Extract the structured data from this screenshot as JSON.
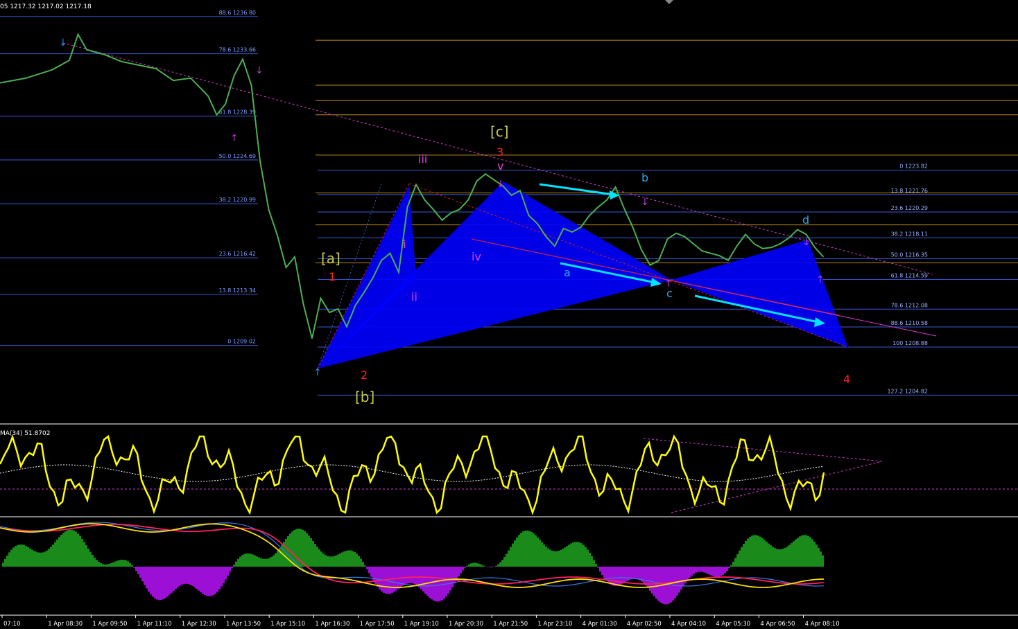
{
  "header": {
    "ohlc_text": "05 1217.32 1217.02 1217.18"
  },
  "indicator": {
    "label": "MA(34) 51.8702"
  },
  "colors": {
    "background": "#000000",
    "price_line": "#4caf50",
    "fib_left": "#3a5bd9",
    "fib_right_blue": "#3a5bd9",
    "fib_right_orange": "#c08a1a",
    "pattern_fill": "#0000ff",
    "trendline": "#d63cd6",
    "arrow": "#00e5ff",
    "rsi_line": "#ffff00",
    "hist_pos": "#1a8a1a",
    "hist_neg": "#9b10d4"
  },
  "chart_data": {
    "type": "line",
    "title": "",
    "y_range": [
      1202.5,
      1238.2
    ],
    "x_labels": [
      "07:10",
      "1 Apr 08:30",
      "1 Apr 09:50",
      "1 Apr 11:10",
      "1 Apr 12:30",
      "1 Apr 13:50",
      "1 Apr 15:10",
      "1 Apr 16:30",
      "1 Apr 17:50",
      "1 Apr 19:10",
      "1 Apr 20:30",
      "1 Apr 21:50",
      "1 Apr 23:10",
      "4 Apr 01:30",
      "4 Apr 02:50",
      "4 Apr 04:10",
      "4 Apr 05:30",
      "4 Apr 06:50",
      "4 Apr 08:10"
    ],
    "price_series": [
      [
        0,
        1231.2
      ],
      [
        3,
        1231.6
      ],
      [
        6,
        1232.3
      ],
      [
        8,
        1233.1
      ],
      [
        9,
        1235.3
      ],
      [
        10,
        1234.0
      ],
      [
        12,
        1233.6
      ],
      [
        14,
        1233.0
      ],
      [
        16,
        1232.7
      ],
      [
        18,
        1232.4
      ],
      [
        20,
        1231.4
      ],
      [
        22,
        1231.6
      ],
      [
        24,
        1230.1
      ],
      [
        25,
        1228.5
      ],
      [
        26,
        1229.4
      ],
      [
        27,
        1231.8
      ],
      [
        28,
        1233.2
      ],
      [
        29,
        1231.0
      ],
      [
        30,
        1224.6
      ],
      [
        31,
        1220.5
      ],
      [
        32,
        1218.3
      ],
      [
        33,
        1215.6
      ],
      [
        34,
        1216.5
      ],
      [
        35,
        1212.5
      ],
      [
        36,
        1209.6
      ],
      [
        37,
        1213.0
      ],
      [
        38,
        1211.8
      ],
      [
        39,
        1212.1
      ],
      [
        40,
        1210.6
      ],
      [
        41,
        1212.4
      ],
      [
        42,
        1213.5
      ],
      [
        43,
        1214.7
      ],
      [
        44,
        1216.2
      ],
      [
        45,
        1216.8
      ],
      [
        46,
        1215.2
      ],
      [
        47,
        1220.7
      ],
      [
        48,
        1222.6
      ],
      [
        49,
        1221.3
      ],
      [
        50,
        1220.5
      ],
      [
        51,
        1219.6
      ],
      [
        52,
        1220.2
      ],
      [
        53,
        1220.5
      ],
      [
        54,
        1221.3
      ],
      [
        55,
        1222.9
      ],
      [
        56,
        1223.5
      ],
      [
        57,
        1223.0
      ],
      [
        58,
        1222.5
      ],
      [
        59,
        1221.7
      ],
      [
        60,
        1222.1
      ],
      [
        61,
        1220.0
      ],
      [
        62,
        1219.3
      ],
      [
        63,
        1218.2
      ],
      [
        64,
        1217.4
      ],
      [
        65,
        1218.9
      ],
      [
        66,
        1218.6
      ],
      [
        67,
        1219.0
      ],
      [
        68,
        1220.0
      ],
      [
        69,
        1220.7
      ],
      [
        70,
        1221.3
      ],
      [
        71,
        1222.4
      ],
      [
        72,
        1220.6
      ],
      [
        73,
        1219.0
      ],
      [
        74,
        1217.1
      ],
      [
        75,
        1215.8
      ],
      [
        76,
        1216.2
      ],
      [
        77,
        1218.0
      ],
      [
        78,
        1218.5
      ],
      [
        79,
        1218.2
      ],
      [
        80,
        1217.6
      ],
      [
        81,
        1217.0
      ],
      [
        82,
        1216.8
      ],
      [
        83,
        1216.6
      ],
      [
        84,
        1216.2
      ],
      [
        85,
        1217.4
      ],
      [
        86,
        1218.4
      ],
      [
        87,
        1217.6
      ],
      [
        88,
        1217.2
      ],
      [
        89,
        1217.3
      ],
      [
        90,
        1217.6
      ],
      [
        91,
        1218.1
      ],
      [
        92,
        1218.8
      ],
      [
        93,
        1218.4
      ],
      [
        94,
        1217.3
      ],
      [
        95,
        1216.5
      ]
    ],
    "fib_left": [
      {
        "label": "88.6 1236.80",
        "price": 1236.8
      },
      {
        "label": "78.6 1233.66",
        "price": 1233.66
      },
      {
        "label": "61.8 1228.39",
        "price": 1228.39
      },
      {
        "label": "50.0 1224.69",
        "price": 1224.69
      },
      {
        "label": "38.2 1220.99",
        "price": 1220.99
      },
      {
        "label": "23.6 1216.42",
        "price": 1216.42
      },
      {
        "label": "13.8 1213.34",
        "price": 1213.34
      },
      {
        "label": "0 1209.02",
        "price": 1209.02
      }
    ],
    "fib_right": [
      {
        "label": "0 1223.82",
        "price": 1223.82
      },
      {
        "label": "13.8 1221.76",
        "price": 1221.76
      },
      {
        "label": "23.6 1220.29",
        "price": 1220.29
      },
      {
        "label": "38.2 1218.11",
        "price": 1218.11
      },
      {
        "label": "50.0 1216.35",
        "price": 1216.35
      },
      {
        "label": "61.8 1214.59",
        "price": 1214.59
      },
      {
        "label": "78.6 1212.08",
        "price": 1212.08
      },
      {
        "label": "88.6 1210.58",
        "price": 1210.58
      },
      {
        "label": "100 1208.88",
        "price": 1208.88
      },
      {
        "label": "127.2 1204.82",
        "price": 1204.82
      }
    ],
    "wave_labels": [
      {
        "text": "[a]",
        "color": "#c8c84a"
      },
      {
        "text": "1",
        "color": "#ff2020"
      },
      {
        "text": "[b]",
        "color": "#c8c84a"
      },
      {
        "text": "2",
        "color": "#ff2020"
      },
      {
        "text": "[c]",
        "color": "#c8c84a"
      },
      {
        "text": "3",
        "color": "#ff2020"
      },
      {
        "text": "4",
        "color": "#ff2020"
      },
      {
        "text": "i",
        "color": "#e040e0"
      },
      {
        "text": "ii",
        "color": "#e040e0"
      },
      {
        "text": "iii",
        "color": "#e040e0"
      },
      {
        "text": "iv",
        "color": "#e040e0"
      },
      {
        "text": "v",
        "color": "#e040e0"
      },
      {
        "text": "a",
        "color": "#30a8e8"
      },
      {
        "text": "b",
        "color": "#30a8e8"
      },
      {
        "text": "c",
        "color": "#30a8e8"
      },
      {
        "text": "d",
        "color": "#30a8e8"
      }
    ]
  }
}
